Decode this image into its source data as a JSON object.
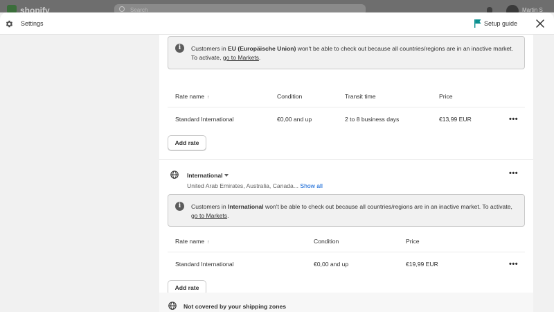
{
  "background": {
    "brand": "shopify",
    "search_placeholder": "Search",
    "user_name": "Martin S"
  },
  "header": {
    "title": "Settings",
    "setup_guide": "Setup guide",
    "accent_color": "#0a8f8f"
  },
  "eu_zone": {
    "banner": {
      "prefix": "Customers in ",
      "region": "EU (Europäische Union)",
      "suffix": " won't be able to check out because all countries/regions are in an inactive market.",
      "line2_prefix": "To activate, ",
      "link": "go to Markets",
      "end": "."
    },
    "columns": [
      "Rate name",
      "Condition",
      "Transit time",
      "Price"
    ],
    "rates": [
      {
        "name": "Standard International",
        "condition": "€0,00 and up",
        "transit": "2 to 8 business days",
        "price": "€13,99 EUR"
      }
    ],
    "add_rate": "Add rate"
  },
  "international_zone": {
    "name": "International",
    "countries": "United Arab Emirates, Australia, Canada...",
    "show_all": "Show all",
    "banner": {
      "prefix": "Customers in ",
      "region": "International",
      "suffix": " won't be able to check out because all countries/regions are in an inactive market. To activate,",
      "link": "go to Markets",
      "end": "."
    },
    "columns": [
      "Rate name",
      "Condition",
      "Price"
    ],
    "rates": [
      {
        "name": "Standard International",
        "condition": "€0,00 and up",
        "price": "€19,99 EUR"
      }
    ],
    "add_rate": "Add rate"
  },
  "not_covered": {
    "label": "Not covered by your shipping zones"
  },
  "icons": {
    "more": "•••",
    "sort": "↑",
    "info": "i"
  }
}
